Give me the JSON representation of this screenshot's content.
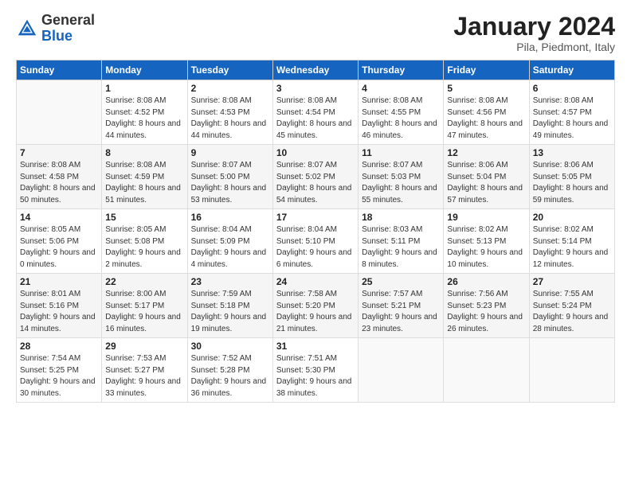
{
  "header": {
    "logo_general": "General",
    "logo_blue": "Blue",
    "month_year": "January 2024",
    "location": "Pila, Piedmont, Italy"
  },
  "weekdays": [
    "Sunday",
    "Monday",
    "Tuesday",
    "Wednesday",
    "Thursday",
    "Friday",
    "Saturday"
  ],
  "weeks": [
    [
      {
        "day": "",
        "sunrise": "",
        "sunset": "",
        "daylight": ""
      },
      {
        "day": "1",
        "sunrise": "Sunrise: 8:08 AM",
        "sunset": "Sunset: 4:52 PM",
        "daylight": "Daylight: 8 hours and 44 minutes."
      },
      {
        "day": "2",
        "sunrise": "Sunrise: 8:08 AM",
        "sunset": "Sunset: 4:53 PM",
        "daylight": "Daylight: 8 hours and 44 minutes."
      },
      {
        "day": "3",
        "sunrise": "Sunrise: 8:08 AM",
        "sunset": "Sunset: 4:54 PM",
        "daylight": "Daylight: 8 hours and 45 minutes."
      },
      {
        "day": "4",
        "sunrise": "Sunrise: 8:08 AM",
        "sunset": "Sunset: 4:55 PM",
        "daylight": "Daylight: 8 hours and 46 minutes."
      },
      {
        "day": "5",
        "sunrise": "Sunrise: 8:08 AM",
        "sunset": "Sunset: 4:56 PM",
        "daylight": "Daylight: 8 hours and 47 minutes."
      },
      {
        "day": "6",
        "sunrise": "Sunrise: 8:08 AM",
        "sunset": "Sunset: 4:57 PM",
        "daylight": "Daylight: 8 hours and 49 minutes."
      }
    ],
    [
      {
        "day": "7",
        "sunrise": "Sunrise: 8:08 AM",
        "sunset": "Sunset: 4:58 PM",
        "daylight": "Daylight: 8 hours and 50 minutes."
      },
      {
        "day": "8",
        "sunrise": "Sunrise: 8:08 AM",
        "sunset": "Sunset: 4:59 PM",
        "daylight": "Daylight: 8 hours and 51 minutes."
      },
      {
        "day": "9",
        "sunrise": "Sunrise: 8:07 AM",
        "sunset": "Sunset: 5:00 PM",
        "daylight": "Daylight: 8 hours and 53 minutes."
      },
      {
        "day": "10",
        "sunrise": "Sunrise: 8:07 AM",
        "sunset": "Sunset: 5:02 PM",
        "daylight": "Daylight: 8 hours and 54 minutes."
      },
      {
        "day": "11",
        "sunrise": "Sunrise: 8:07 AM",
        "sunset": "Sunset: 5:03 PM",
        "daylight": "Daylight: 8 hours and 55 minutes."
      },
      {
        "day": "12",
        "sunrise": "Sunrise: 8:06 AM",
        "sunset": "Sunset: 5:04 PM",
        "daylight": "Daylight: 8 hours and 57 minutes."
      },
      {
        "day": "13",
        "sunrise": "Sunrise: 8:06 AM",
        "sunset": "Sunset: 5:05 PM",
        "daylight": "Daylight: 8 hours and 59 minutes."
      }
    ],
    [
      {
        "day": "14",
        "sunrise": "Sunrise: 8:05 AM",
        "sunset": "Sunset: 5:06 PM",
        "daylight": "Daylight: 9 hours and 0 minutes."
      },
      {
        "day": "15",
        "sunrise": "Sunrise: 8:05 AM",
        "sunset": "Sunset: 5:08 PM",
        "daylight": "Daylight: 9 hours and 2 minutes."
      },
      {
        "day": "16",
        "sunrise": "Sunrise: 8:04 AM",
        "sunset": "Sunset: 5:09 PM",
        "daylight": "Daylight: 9 hours and 4 minutes."
      },
      {
        "day": "17",
        "sunrise": "Sunrise: 8:04 AM",
        "sunset": "Sunset: 5:10 PM",
        "daylight": "Daylight: 9 hours and 6 minutes."
      },
      {
        "day": "18",
        "sunrise": "Sunrise: 8:03 AM",
        "sunset": "Sunset: 5:11 PM",
        "daylight": "Daylight: 9 hours and 8 minutes."
      },
      {
        "day": "19",
        "sunrise": "Sunrise: 8:02 AM",
        "sunset": "Sunset: 5:13 PM",
        "daylight": "Daylight: 9 hours and 10 minutes."
      },
      {
        "day": "20",
        "sunrise": "Sunrise: 8:02 AM",
        "sunset": "Sunset: 5:14 PM",
        "daylight": "Daylight: 9 hours and 12 minutes."
      }
    ],
    [
      {
        "day": "21",
        "sunrise": "Sunrise: 8:01 AM",
        "sunset": "Sunset: 5:16 PM",
        "daylight": "Daylight: 9 hours and 14 minutes."
      },
      {
        "day": "22",
        "sunrise": "Sunrise: 8:00 AM",
        "sunset": "Sunset: 5:17 PM",
        "daylight": "Daylight: 9 hours and 16 minutes."
      },
      {
        "day": "23",
        "sunrise": "Sunrise: 7:59 AM",
        "sunset": "Sunset: 5:18 PM",
        "daylight": "Daylight: 9 hours and 19 minutes."
      },
      {
        "day": "24",
        "sunrise": "Sunrise: 7:58 AM",
        "sunset": "Sunset: 5:20 PM",
        "daylight": "Daylight: 9 hours and 21 minutes."
      },
      {
        "day": "25",
        "sunrise": "Sunrise: 7:57 AM",
        "sunset": "Sunset: 5:21 PM",
        "daylight": "Daylight: 9 hours and 23 minutes."
      },
      {
        "day": "26",
        "sunrise": "Sunrise: 7:56 AM",
        "sunset": "Sunset: 5:23 PM",
        "daylight": "Daylight: 9 hours and 26 minutes."
      },
      {
        "day": "27",
        "sunrise": "Sunrise: 7:55 AM",
        "sunset": "Sunset: 5:24 PM",
        "daylight": "Daylight: 9 hours and 28 minutes."
      }
    ],
    [
      {
        "day": "28",
        "sunrise": "Sunrise: 7:54 AM",
        "sunset": "Sunset: 5:25 PM",
        "daylight": "Daylight: 9 hours and 30 minutes."
      },
      {
        "day": "29",
        "sunrise": "Sunrise: 7:53 AM",
        "sunset": "Sunset: 5:27 PM",
        "daylight": "Daylight: 9 hours and 33 minutes."
      },
      {
        "day": "30",
        "sunrise": "Sunrise: 7:52 AM",
        "sunset": "Sunset: 5:28 PM",
        "daylight": "Daylight: 9 hours and 36 minutes."
      },
      {
        "day": "31",
        "sunrise": "Sunrise: 7:51 AM",
        "sunset": "Sunset: 5:30 PM",
        "daylight": "Daylight: 9 hours and 38 minutes."
      },
      {
        "day": "",
        "sunrise": "",
        "sunset": "",
        "daylight": ""
      },
      {
        "day": "",
        "sunrise": "",
        "sunset": "",
        "daylight": ""
      },
      {
        "day": "",
        "sunrise": "",
        "sunset": "",
        "daylight": ""
      }
    ]
  ]
}
